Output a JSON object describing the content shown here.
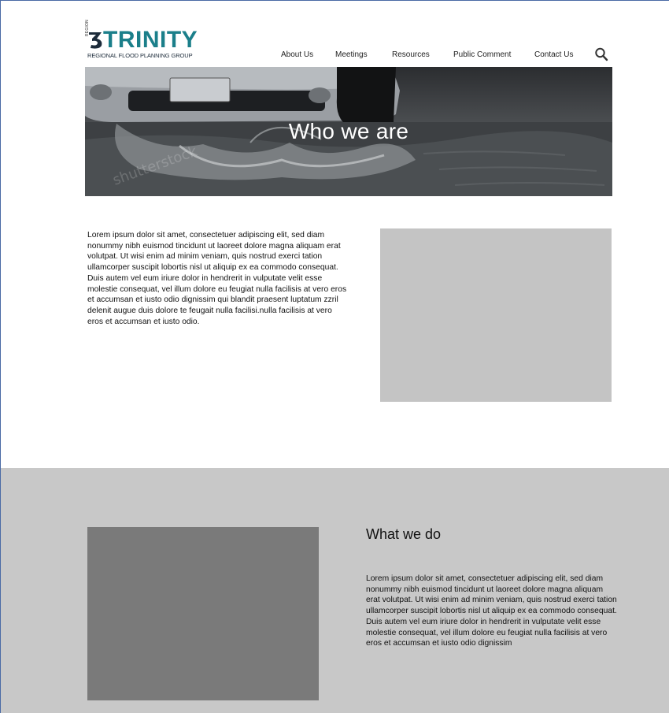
{
  "brand": {
    "region_tag": "REGION",
    "name": "TRINITY",
    "subtitle": "REGIONAL FLOOD PLANNING GROUP",
    "accent_color": "#1b7f8a"
  },
  "nav": {
    "items": [
      {
        "label": "About Us"
      },
      {
        "label": "Meetings"
      },
      {
        "label": "Resources"
      },
      {
        "label": "Public Comment"
      },
      {
        "label": "Contact Us"
      }
    ],
    "search_icon": "search-icon"
  },
  "hero": {
    "title": "Who we are",
    "watermark": "shutterstock"
  },
  "who": {
    "body": "Lorem ipsum dolor sit amet, consectetuer adipiscing elit, sed diam nonummy nibh euismod tincidunt ut laoreet dolore magna aliquam erat volutpat. Ut wisi enim ad minim veniam, quis nostrud exerci tation ullamcorper suscipit lobortis nisl ut aliquip ex ea commodo consequat. Duis autem vel eum iriure dolor in hendrerit in vulputate velit esse molestie consequat, vel illum dolore eu feugiat nulla facilisis at vero eros et accumsan et iusto odio dignissim qui blandit praesent luptatum zzril delenit augue duis dolore te feugait nulla facilisi.nulla facilisis at vero eros et accumsan et iusto odio."
  },
  "what": {
    "title": "What we do",
    "body": "Lorem ipsum dolor sit amet, consectetuer adipiscing elit, sed diam nonummy nibh euismod tincidunt ut laoreet dolore magna aliquam erat volutpat. Ut wisi enim ad minim veniam, quis nostrud exerci tation ullamcorper suscipit lobortis nisl ut aliquip ex ea commodo consequat. Duis autem vel eum iriure dolor in hendrerit in vulputate velit esse molestie consequat, vel illum dolore eu feugiat nulla facilisis at vero eros et accumsan et iusto odio dignissim"
  }
}
